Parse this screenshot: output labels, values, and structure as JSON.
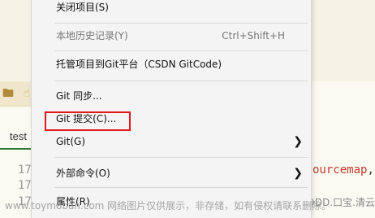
{
  "editor": {
    "tab_label": "test",
    "line_numbers": [
      "17",
      "17",
      "17"
    ],
    "code_fragment": "ourcemap",
    "code_punct": ","
  },
  "context_menu": {
    "items": [
      {
        "label": "关闭项目(S)",
        "shortcut": "",
        "disabled": false,
        "submenu": false
      },
      {
        "label": "本地历史记录(Y)",
        "shortcut": "Ctrl+Shift+H",
        "disabled": true,
        "submenu": false
      },
      {
        "label": "托管项目到Git平台（CSDN GitCode)",
        "shortcut": "",
        "disabled": false,
        "submenu": false
      },
      {
        "label": "Git 同步...",
        "shortcut": "",
        "disabled": false,
        "submenu": false
      },
      {
        "label": "Git 提交(C)...",
        "shortcut": "",
        "disabled": false,
        "submenu": false
      },
      {
        "label": "Git(G)",
        "shortcut": "",
        "disabled": false,
        "submenu": true
      },
      {
        "label": "外部命令(O)",
        "shortcut": "",
        "disabled": false,
        "submenu": true
      },
      {
        "label": "属性(R)",
        "shortcut": "",
        "disabled": false,
        "submenu": false
      }
    ],
    "highlight_color": "#e0191b"
  },
  "watermarks": {
    "right": "CSDN @DD.口宝.清云",
    "bottom": "www.toymoban.com 网络图片仅供展示，非存储，如有侵权请联系删除。"
  },
  "icons": [
    "folder-icon",
    "hand-icon",
    "chevron-right-icon"
  ]
}
